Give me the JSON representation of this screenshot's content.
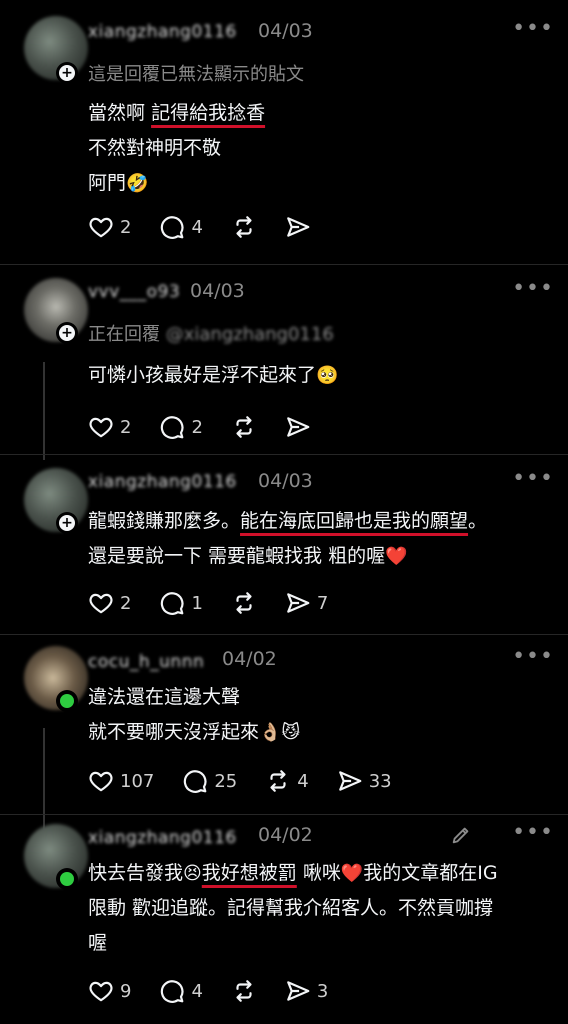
{
  "posts": [
    {
      "username": "xiangzhang0116",
      "date": "04/03",
      "sub_prefix": "這是回覆已無法顯示的貼文",
      "lines": [
        "當然啊",
        "記得給我捻香",
        "不然對神明不敬",
        "阿門",
        "🤣"
      ],
      "likes": "2",
      "comments": "4",
      "reposts": "",
      "shares": ""
    },
    {
      "username": "vvv___o93",
      "date": "04/03",
      "sub_prefix": "正在回覆",
      "sub_handle": "@xiangzhang0116",
      "lines": [
        "可憐小孩最好是浮不起來了",
        "🥺"
      ],
      "likes": "2",
      "comments": "2",
      "reposts": "",
      "shares": ""
    },
    {
      "username": "xiangzhang0116",
      "date": "04/03",
      "lines": [
        "龍蝦錢賺那麼多",
        "。",
        "能在海底回歸也是我的願望",
        "。",
        "還是要說一下 需要龍蝦找我 粗的喔",
        "❤️"
      ],
      "likes": "2",
      "comments": "1",
      "reposts": "",
      "shares": "7"
    },
    {
      "username": "cocu_h_unnn",
      "date": "04/02",
      "lines": [
        "違法還在這邊大聲",
        "就不要哪天沒浮起來",
        "👌🏼😼"
      ],
      "likes": "107",
      "comments": "25",
      "reposts": "4",
      "shares": "33"
    },
    {
      "username": "xiangzhang0116",
      "date": "04/02",
      "lines": [
        "快去告發我",
        "😣",
        "我好想被罰",
        " 啾咪",
        "❤️",
        "我的文章都在IG",
        "限動 歡迎追蹤。記得幫我介紹客人。不然貢咖撐",
        "喔"
      ],
      "likes": "9",
      "comments": "4",
      "reposts": "",
      "shares": "3"
    }
  ],
  "icons": {
    "like": "heart-icon",
    "comment": "comment-bubble-icon",
    "repost": "repost-icon",
    "share": "send-icon",
    "more": "more-icon",
    "edit": "pencil-icon"
  }
}
